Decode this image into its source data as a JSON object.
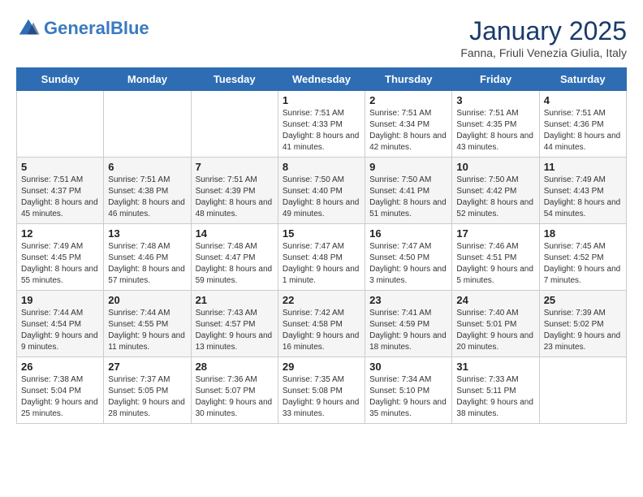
{
  "header": {
    "logo_line1": "General",
    "logo_line2": "Blue",
    "month": "January 2025",
    "location": "Fanna, Friuli Venezia Giulia, Italy"
  },
  "weekdays": [
    "Sunday",
    "Monday",
    "Tuesday",
    "Wednesday",
    "Thursday",
    "Friday",
    "Saturday"
  ],
  "weeks": [
    [
      {
        "day": "",
        "info": ""
      },
      {
        "day": "",
        "info": ""
      },
      {
        "day": "",
        "info": ""
      },
      {
        "day": "1",
        "info": "Sunrise: 7:51 AM\nSunset: 4:33 PM\nDaylight: 8 hours and 41 minutes."
      },
      {
        "day": "2",
        "info": "Sunrise: 7:51 AM\nSunset: 4:34 PM\nDaylight: 8 hours and 42 minutes."
      },
      {
        "day": "3",
        "info": "Sunrise: 7:51 AM\nSunset: 4:35 PM\nDaylight: 8 hours and 43 minutes."
      },
      {
        "day": "4",
        "info": "Sunrise: 7:51 AM\nSunset: 4:36 PM\nDaylight: 8 hours and 44 minutes."
      }
    ],
    [
      {
        "day": "5",
        "info": "Sunrise: 7:51 AM\nSunset: 4:37 PM\nDaylight: 8 hours and 45 minutes."
      },
      {
        "day": "6",
        "info": "Sunrise: 7:51 AM\nSunset: 4:38 PM\nDaylight: 8 hours and 46 minutes."
      },
      {
        "day": "7",
        "info": "Sunrise: 7:51 AM\nSunset: 4:39 PM\nDaylight: 8 hours and 48 minutes."
      },
      {
        "day": "8",
        "info": "Sunrise: 7:50 AM\nSunset: 4:40 PM\nDaylight: 8 hours and 49 minutes."
      },
      {
        "day": "9",
        "info": "Sunrise: 7:50 AM\nSunset: 4:41 PM\nDaylight: 8 hours and 51 minutes."
      },
      {
        "day": "10",
        "info": "Sunrise: 7:50 AM\nSunset: 4:42 PM\nDaylight: 8 hours and 52 minutes."
      },
      {
        "day": "11",
        "info": "Sunrise: 7:49 AM\nSunset: 4:43 PM\nDaylight: 8 hours and 54 minutes."
      }
    ],
    [
      {
        "day": "12",
        "info": "Sunrise: 7:49 AM\nSunset: 4:45 PM\nDaylight: 8 hours and 55 minutes."
      },
      {
        "day": "13",
        "info": "Sunrise: 7:48 AM\nSunset: 4:46 PM\nDaylight: 8 hours and 57 minutes."
      },
      {
        "day": "14",
        "info": "Sunrise: 7:48 AM\nSunset: 4:47 PM\nDaylight: 8 hours and 59 minutes."
      },
      {
        "day": "15",
        "info": "Sunrise: 7:47 AM\nSunset: 4:48 PM\nDaylight: 9 hours and 1 minute."
      },
      {
        "day": "16",
        "info": "Sunrise: 7:47 AM\nSunset: 4:50 PM\nDaylight: 9 hours and 3 minutes."
      },
      {
        "day": "17",
        "info": "Sunrise: 7:46 AM\nSunset: 4:51 PM\nDaylight: 9 hours and 5 minutes."
      },
      {
        "day": "18",
        "info": "Sunrise: 7:45 AM\nSunset: 4:52 PM\nDaylight: 9 hours and 7 minutes."
      }
    ],
    [
      {
        "day": "19",
        "info": "Sunrise: 7:44 AM\nSunset: 4:54 PM\nDaylight: 9 hours and 9 minutes."
      },
      {
        "day": "20",
        "info": "Sunrise: 7:44 AM\nSunset: 4:55 PM\nDaylight: 9 hours and 11 minutes."
      },
      {
        "day": "21",
        "info": "Sunrise: 7:43 AM\nSunset: 4:57 PM\nDaylight: 9 hours and 13 minutes."
      },
      {
        "day": "22",
        "info": "Sunrise: 7:42 AM\nSunset: 4:58 PM\nDaylight: 9 hours and 16 minutes."
      },
      {
        "day": "23",
        "info": "Sunrise: 7:41 AM\nSunset: 4:59 PM\nDaylight: 9 hours and 18 minutes."
      },
      {
        "day": "24",
        "info": "Sunrise: 7:40 AM\nSunset: 5:01 PM\nDaylight: 9 hours and 20 minutes."
      },
      {
        "day": "25",
        "info": "Sunrise: 7:39 AM\nSunset: 5:02 PM\nDaylight: 9 hours and 23 minutes."
      }
    ],
    [
      {
        "day": "26",
        "info": "Sunrise: 7:38 AM\nSunset: 5:04 PM\nDaylight: 9 hours and 25 minutes."
      },
      {
        "day": "27",
        "info": "Sunrise: 7:37 AM\nSunset: 5:05 PM\nDaylight: 9 hours and 28 minutes."
      },
      {
        "day": "28",
        "info": "Sunrise: 7:36 AM\nSunset: 5:07 PM\nDaylight: 9 hours and 30 minutes."
      },
      {
        "day": "29",
        "info": "Sunrise: 7:35 AM\nSunset: 5:08 PM\nDaylight: 9 hours and 33 minutes."
      },
      {
        "day": "30",
        "info": "Sunrise: 7:34 AM\nSunset: 5:10 PM\nDaylight: 9 hours and 35 minutes."
      },
      {
        "day": "31",
        "info": "Sunrise: 7:33 AM\nSunset: 5:11 PM\nDaylight: 9 hours and 38 minutes."
      },
      {
        "day": "",
        "info": ""
      }
    ]
  ]
}
